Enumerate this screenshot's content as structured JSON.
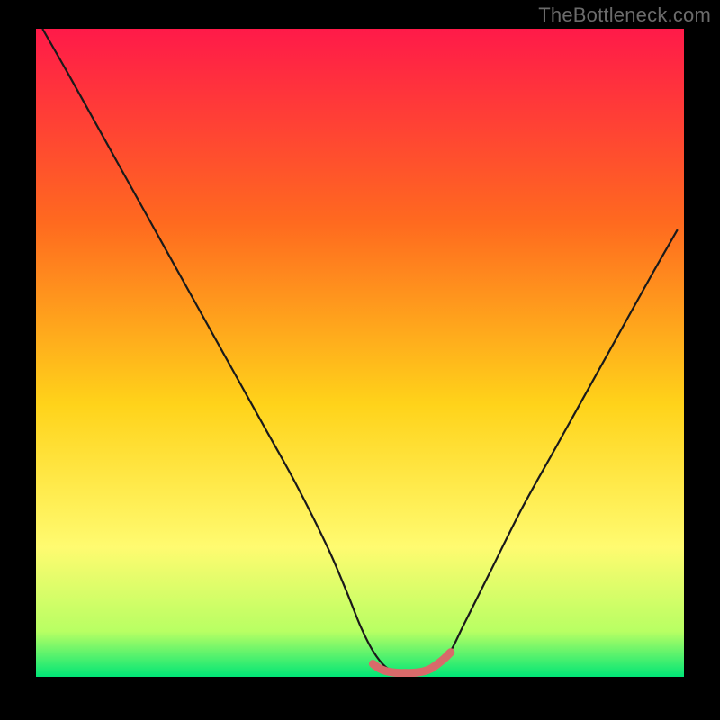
{
  "watermark": "TheBottleneck.com",
  "palette": {
    "bg": "#000000",
    "grad_top": "#ff1a49",
    "grad_mid1": "#ff6a1f",
    "grad_mid2": "#ffd31a",
    "grad_low": "#fffb70",
    "grad_bottom1": "#b8ff63",
    "grad_bottom2": "#00e676",
    "curve": "#1a1a1a",
    "base_marker": "#d86a6a"
  },
  "chart_data": {
    "type": "line",
    "title": "",
    "xlabel": "",
    "ylabel": "",
    "xlim": [
      0,
      100
    ],
    "ylim": [
      0,
      100
    ],
    "series": [
      {
        "name": "curve",
        "x": [
          1,
          5,
          10,
          15,
          20,
          25,
          30,
          35,
          40,
          45,
          48,
          50,
          52,
          54,
          56,
          58,
          60,
          62,
          64,
          66,
          70,
          75,
          80,
          85,
          90,
          95,
          99
        ],
        "values": [
          100,
          93,
          84,
          75,
          66,
          57,
          48,
          39,
          30,
          20,
          13,
          8,
          4,
          1.5,
          0.7,
          0.6,
          0.7,
          1.5,
          4,
          8,
          16,
          26,
          35,
          44,
          53,
          62,
          69
        ]
      },
      {
        "name": "base-marker",
        "x": [
          52,
          53,
          54,
          55,
          56,
          57,
          58,
          59,
          60,
          61,
          62,
          63,
          64
        ],
        "values": [
          2.0,
          1.3,
          0.9,
          0.7,
          0.6,
          0.6,
          0.6,
          0.7,
          0.9,
          1.3,
          2.0,
          2.8,
          3.8
        ]
      }
    ],
    "gradient_stops": [
      {
        "offset": 0.0,
        "key": "grad_top"
      },
      {
        "offset": 0.3,
        "key": "grad_mid1"
      },
      {
        "offset": 0.58,
        "key": "grad_mid2"
      },
      {
        "offset": 0.8,
        "key": "grad_low"
      },
      {
        "offset": 0.93,
        "key": "grad_bottom1"
      },
      {
        "offset": 1.0,
        "key": "grad_bottom2"
      }
    ]
  }
}
